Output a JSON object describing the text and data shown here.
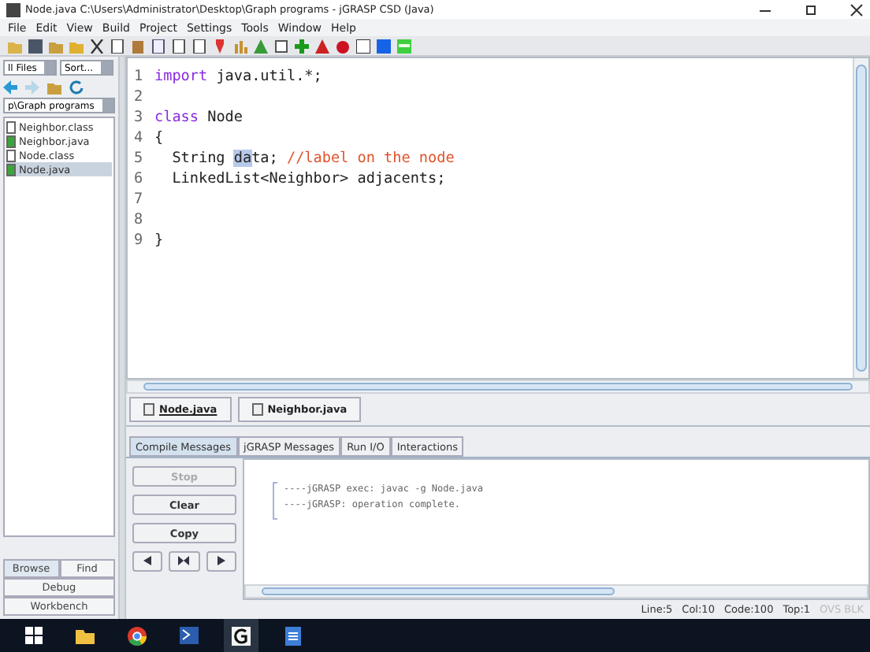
{
  "window": {
    "title": "Node.java  C:\\Users\\Administrator\\Desktop\\Graph programs - jGRASP CSD (Java)"
  },
  "menu": [
    "File",
    "Edit",
    "View",
    "Build",
    "Project",
    "Settings",
    "Tools",
    "Window",
    "Help"
  ],
  "browser": {
    "filter": "ll Files",
    "sort": "Sort...",
    "folder": "p\\Graph programs",
    "files": [
      {
        "name": "Neighbor.class",
        "kind": "class",
        "selected": false
      },
      {
        "name": "Neighbor.java",
        "kind": "java",
        "selected": false
      },
      {
        "name": "Node.class",
        "kind": "class",
        "selected": false
      },
      {
        "name": "Node.java",
        "kind": "java",
        "selected": true
      }
    ],
    "tabs": [
      {
        "label": "Browse",
        "selected": true
      },
      {
        "label": "Find",
        "selected": false
      }
    ],
    "lower_tabs": [
      "Debug",
      "Workbench"
    ]
  },
  "editor": {
    "lines": [
      {
        "number": "1",
        "tokens": [
          {
            "kind": "keyword",
            "text": "import"
          },
          {
            "kind": "plain",
            "text": " java.util.*;"
          }
        ]
      },
      {
        "number": "2"
      },
      {
        "number": "3",
        "tokens": [
          {
            "kind": "keyword",
            "text": "class"
          },
          {
            "kind": "plain",
            "text": " Node"
          }
        ]
      },
      {
        "number": "4",
        "tokens": [
          {
            "kind": "plain",
            "text": "{"
          }
        ]
      },
      {
        "number": "5",
        "tokens": [
          {
            "kind": "plain",
            "text": "  String "
          },
          {
            "kind": "selection",
            "text": "da"
          },
          {
            "kind": "plain",
            "text": "ta; "
          },
          {
            "kind": "comment",
            "text": "//label on the node"
          }
        ]
      },
      {
        "number": "6",
        "tokens": [
          {
            "kind": "plain",
            "text": "  LinkedList<Neighbor> adjacents;"
          }
        ]
      },
      {
        "number": "7"
      },
      {
        "number": "8"
      },
      {
        "number": "9",
        "tokens": [
          {
            "kind": "plain",
            "text": "}"
          }
        ]
      }
    ]
  },
  "file_tabs": [
    {
      "label": "Node.java",
      "selected": true
    },
    {
      "label": "Neighbor.java",
      "selected": false
    }
  ],
  "message_tabs": [
    {
      "label": "Compile Messages",
      "selected": true
    },
    {
      "label": "jGRASP Messages",
      "selected": false
    },
    {
      "label": "Run I/O",
      "selected": false
    },
    {
      "label": "Interactions",
      "selected": false
    }
  ],
  "message_buttons": [
    {
      "label": "Stop",
      "disabled": true
    },
    {
      "label": "Clear",
      "disabled": false
    },
    {
      "label": "Copy",
      "disabled": false
    }
  ],
  "messages": [
    "----jGRASP exec: javac -g Node.java",
    "----jGRASP: operation complete."
  ],
  "status_bar": {
    "items": [
      {
        "text": "Line:5",
        "dimmed": false
      },
      {
        "text": "Col:10",
        "dimmed": false
      },
      {
        "text": "Code:100",
        "dimmed": false
      },
      {
        "text": "Top:1",
        "dimmed": false
      },
      {
        "text": "OVS BLK",
        "dimmed": true
      }
    ]
  }
}
